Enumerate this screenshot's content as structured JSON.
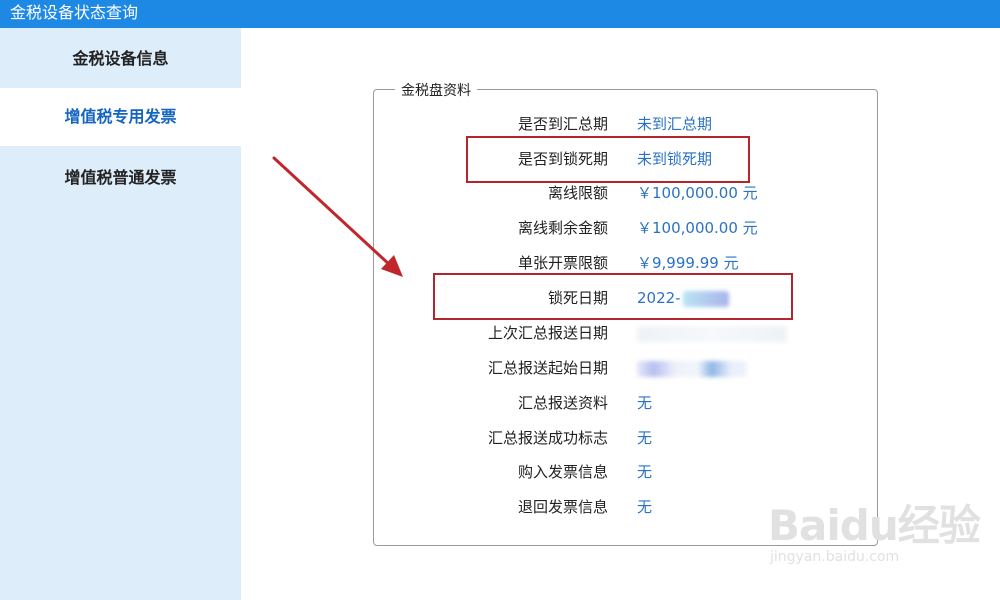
{
  "window": {
    "title": "金税设备状态查询"
  },
  "sidebar": {
    "items": [
      {
        "label": "金税设备信息",
        "active": false
      },
      {
        "label": "增值税专用发票",
        "active": true
      },
      {
        "label": "增值税普通发票",
        "active": false
      }
    ]
  },
  "panel": {
    "legend": "金税盘资料",
    "rows": [
      {
        "label": "是否到汇总期",
        "value": "未到汇总期"
      },
      {
        "label": "是否到锁死期",
        "value": "未到锁死期"
      },
      {
        "label": "离线限额",
        "value": "￥100,000.00 元"
      },
      {
        "label": "离线剩余金额",
        "value": "￥100,000.00 元"
      },
      {
        "label": "单张开票限额",
        "value": "￥9,999.99 元"
      },
      {
        "label": "锁死日期",
        "value": "2022-"
      },
      {
        "label": "上次汇总报送日期",
        "value": ""
      },
      {
        "label": "汇总报送起始日期",
        "value": ""
      },
      {
        "label": "汇总报送资料",
        "value": "无"
      },
      {
        "label": "汇总报送成功标志",
        "value": "无"
      },
      {
        "label": "购入发票信息",
        "value": "无"
      },
      {
        "label": "退回发票信息",
        "value": "无"
      }
    ]
  },
  "annotations": {
    "highlight_color": "#b3262d",
    "arrow_color": "#c0272d"
  },
  "watermark": {
    "logo": "Baidu经验",
    "sub": "jingyan.baidu.com"
  }
}
